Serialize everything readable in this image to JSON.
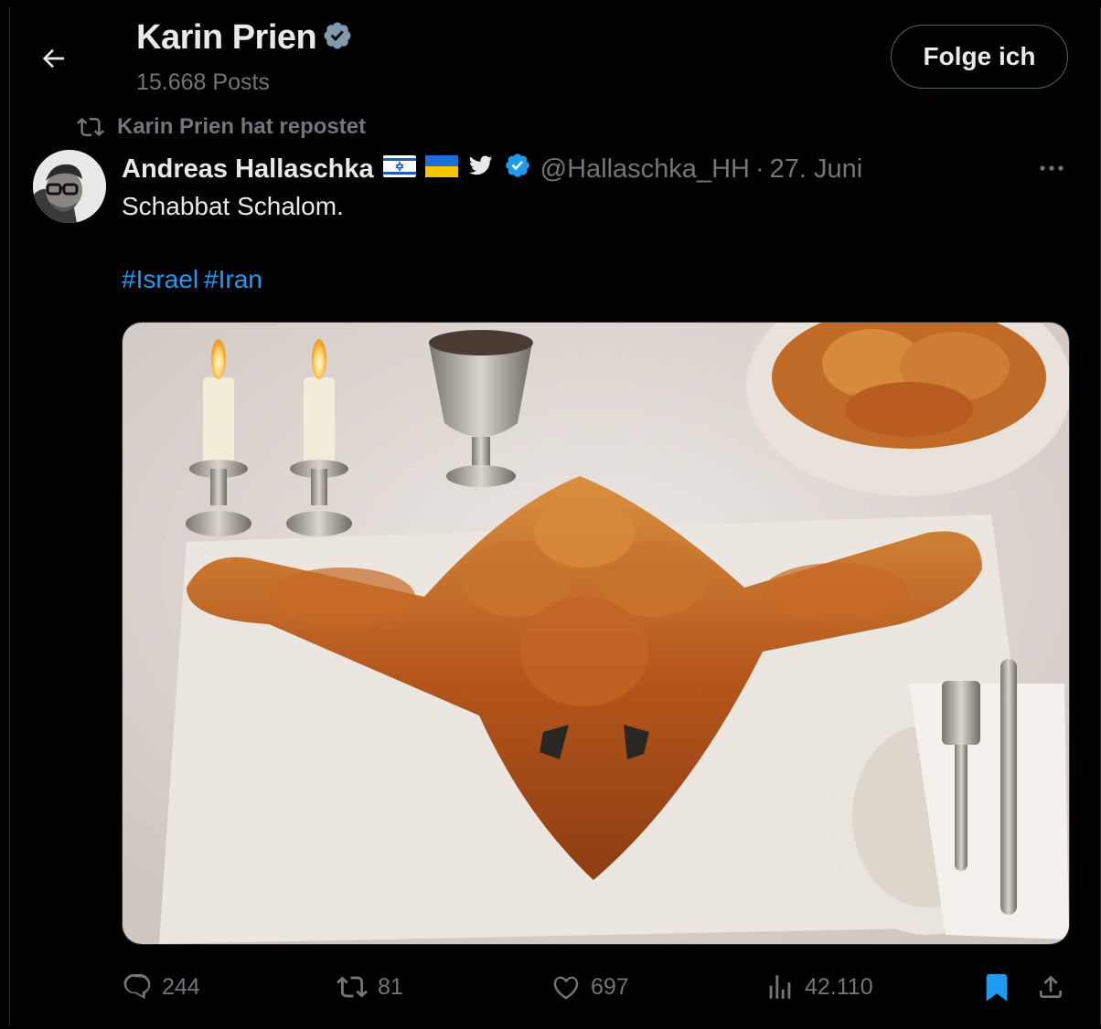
{
  "header": {
    "profile_name": "Karin Prien",
    "posts_count": "15.668 Posts",
    "follow_label": "Folge ich"
  },
  "repost": {
    "label": "Karin Prien hat repostet"
  },
  "tweet": {
    "author_name": "Andreas Hallaschka",
    "handle": "@Hallaschka_HH",
    "separator": "·",
    "date": "27. Juni",
    "text": "Schabbat Schalom.",
    "hashtags": [
      "#Israel",
      "#Iran"
    ]
  },
  "actions": {
    "replies": "244",
    "reposts": "81",
    "likes": "697",
    "views": "42.110"
  },
  "colors": {
    "background": "#000000",
    "text": "#e7e9ea",
    "muted": "#71767b",
    "accent": "#1d9bf0"
  },
  "icons": [
    "back-arrow-icon",
    "verified-badge-icon",
    "repost-icon",
    "israel-flag-icon",
    "ukraine-flag-icon",
    "bird-icon",
    "more-icon",
    "reply-icon",
    "like-icon",
    "views-icon",
    "bookmark-icon",
    "share-icon"
  ]
}
